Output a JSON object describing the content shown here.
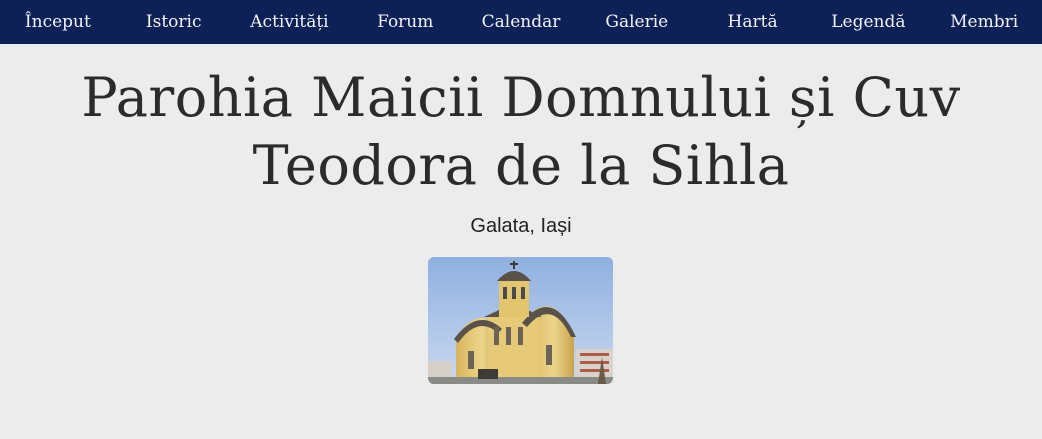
{
  "nav": {
    "items": [
      {
        "label": "Început"
      },
      {
        "label": "Istoric"
      },
      {
        "label": "Activități"
      },
      {
        "label": "Forum"
      },
      {
        "label": "Calendar"
      },
      {
        "label": "Galerie"
      },
      {
        "label": "Hartă"
      },
      {
        "label": "Legendă"
      },
      {
        "label": "Membri"
      }
    ]
  },
  "header": {
    "title_line1": "Parohia Maicii Domnului și Cuv",
    "title_line2": "Teodora de la Sihla",
    "subtitle": "Galata, Iași"
  },
  "colors": {
    "nav_background": "#0d2156",
    "page_background": "#ececec",
    "title_text": "#2b2b2b"
  }
}
